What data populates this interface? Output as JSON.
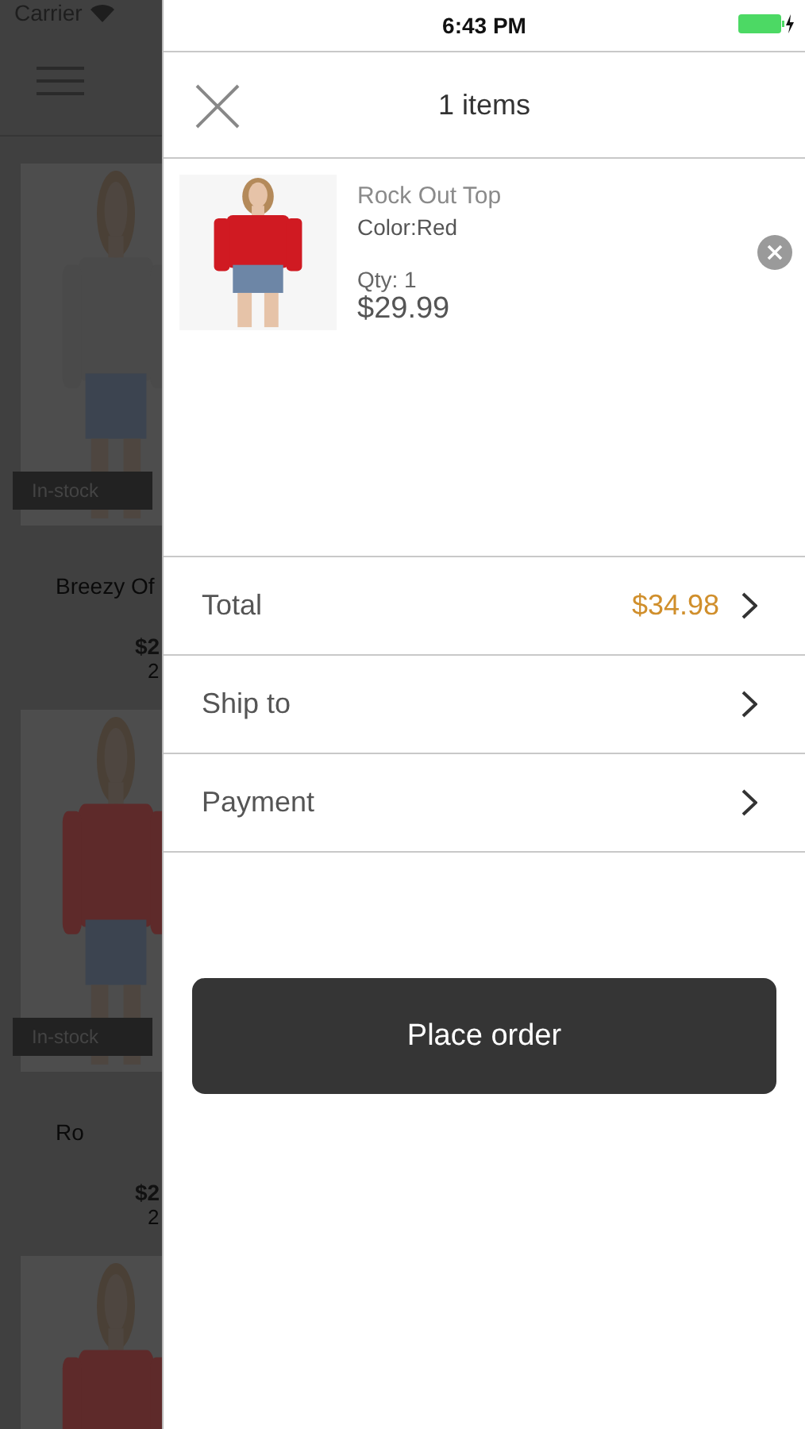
{
  "status_bar": {
    "carrier": "Carrier",
    "time": "6:43 PM"
  },
  "background": {
    "products": [
      {
        "kind": "product",
        "tag": "In-stock",
        "name": "Breezy Of",
        "price": "$2",
        "line_3": "2"
      },
      {
        "kind": "product",
        "tag": "In-stock",
        "name": "Ro",
        "price": "$2",
        "line_3": "2"
      },
      {
        "kind": "picture"
      }
    ]
  },
  "cart": {
    "title": "1 items",
    "items": [
      {
        "name": "Rock Out Top",
        "variant": "Color:Red",
        "qty": "Qty: 1",
        "price": "$29.99"
      }
    ],
    "rows": [
      {
        "label": "Total",
        "value": "$34.98"
      },
      {
        "label": "Ship to"
      },
      {
        "label": "Payment"
      }
    ],
    "button": "Place order"
  }
}
